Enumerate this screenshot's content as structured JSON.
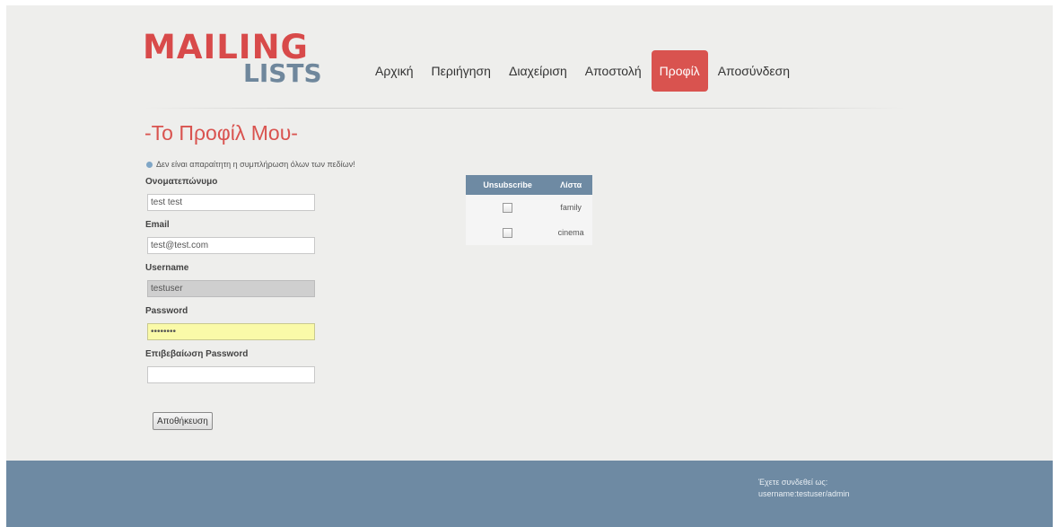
{
  "brand": {
    "logo_top": "MAILING",
    "logo_bottom": "LISTS"
  },
  "nav": {
    "items": [
      {
        "label": "Αρχική",
        "active": false
      },
      {
        "label": "Περιήγηση",
        "active": false
      },
      {
        "label": "Διαχείριση",
        "active": false
      },
      {
        "label": "Αποστολή",
        "active": false
      },
      {
        "label": "Προφίλ",
        "active": true
      },
      {
        "label": "Αποσύνδεση",
        "active": false
      }
    ]
  },
  "page": {
    "title": "-Το Προφίλ Μου-",
    "notice": "Δεν είναι απαραίτητη η συμπλήρωση όλων των πεδίων!"
  },
  "form": {
    "fullname_label": "Ονοματεπώνυμο",
    "fullname_value": "test test",
    "email_label": "Email",
    "email_value": "test@test.com",
    "username_label": "Username",
    "username_value": "testuser",
    "password_label": "Password",
    "password_value": "••••••••",
    "confirm_label": "Επιβεβαίωση Password",
    "confirm_value": "",
    "save_label": "Αποθήκευση"
  },
  "subscriptions": {
    "col_unsubscribe": "Unsubscribe",
    "col_list": "Λίστα",
    "rows": [
      {
        "list": "family",
        "unsubscribe": false
      },
      {
        "list": "cinema",
        "unsubscribe": false
      }
    ]
  },
  "footer": {
    "status_line1": "Έχετε συνδεθεί ως:",
    "status_line2": "username:testuser/admin"
  },
  "colors": {
    "accent": "#d9534f",
    "brand_blue": "#6e8aa3"
  }
}
